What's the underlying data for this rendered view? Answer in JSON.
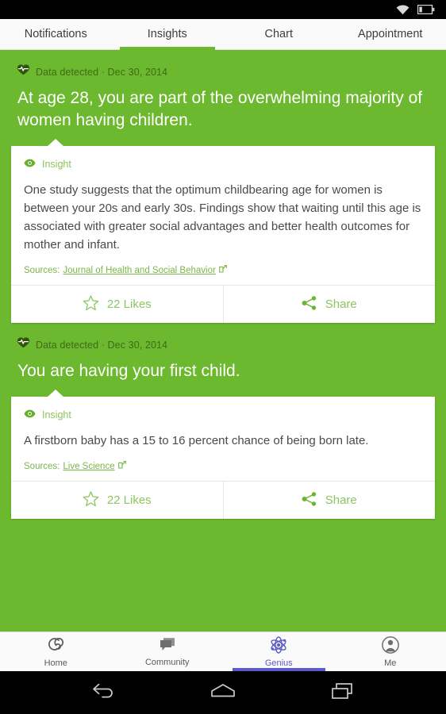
{
  "status_bar": {
    "wifi_icon": "wifi-icon",
    "battery_icon": "battery-low-icon"
  },
  "tabs": [
    {
      "label": "Notifications",
      "active": false
    },
    {
      "label": "Insights",
      "active": true
    },
    {
      "label": "Chart",
      "active": false
    },
    {
      "label": "Appointment",
      "active": false
    }
  ],
  "colors": {
    "brand_green": "#6CB82E",
    "light_green_text": "#8dc55f",
    "meta_green": "#3f6b18",
    "genius_accent": "#5B5BC8"
  },
  "insights": [
    {
      "meta_icon": "heart-pulse-icon",
      "meta": "Data detected · Dec 30, 2014",
      "headline": "At age 28, you are part of the overwhelming majority of women having children.",
      "card": {
        "tag_icon": "eye-icon",
        "tag": "Insight",
        "body": "One study suggests that the optimum childbearing age for women is between your 20s and early 30s. Findings show that waiting until this age is associated with greater social advantages and better health outcomes for mother and infant.",
        "sources_label": "Sources:",
        "source_link": "Journal of Health and Social Behavior",
        "likes": "22 Likes",
        "share": "Share"
      }
    },
    {
      "meta_icon": "heart-pulse-icon",
      "meta": "Data detected · Dec 30, 2014",
      "headline": "You are having your first child.",
      "card": {
        "tag_icon": "eye-icon",
        "tag": "Insight",
        "body": "A firstborn baby has a 15 to 16 percent chance of being born late.",
        "sources_label": "Sources:",
        "source_link": "Live Science",
        "likes": "22 Likes",
        "share": "Share"
      }
    }
  ],
  "bottom_nav": [
    {
      "label": "Home",
      "icon": "spiral-g-icon",
      "active": false
    },
    {
      "label": "Community",
      "icon": "speech-bubble-icon",
      "active": false
    },
    {
      "label": "Genius",
      "icon": "atom-icon",
      "active": true
    },
    {
      "label": "Me",
      "icon": "person-circle-icon",
      "active": false
    }
  ],
  "system_nav": [
    {
      "icon": "back-arrow-icon"
    },
    {
      "icon": "home-icon"
    },
    {
      "icon": "recents-icon"
    }
  ]
}
